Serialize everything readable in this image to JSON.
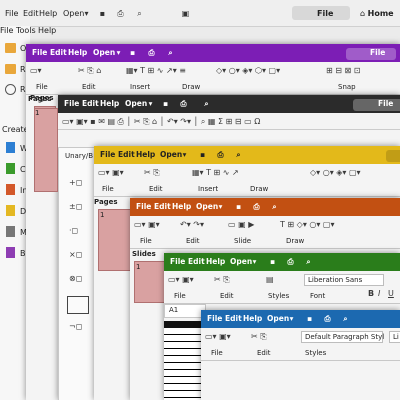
{
  "top_menu": {
    "file": "File",
    "edit": "Edit",
    "help": "Help",
    "open": "Open",
    "file_btn": "File",
    "home": "Home"
  },
  "start_center": {
    "menu": {
      "file": "File",
      "tools": "Tools",
      "help": "Help"
    },
    "create_label": "Create",
    "recent_letters": [
      "O",
      "R",
      "R"
    ],
    "create_letters": [
      "W",
      "C",
      "In",
      "D",
      "M",
      "B"
    ]
  },
  "purple": {
    "menu": {
      "file": "File",
      "edit": "Edit",
      "help": "Help",
      "open": "Open",
      "file_btn": "File"
    },
    "groups": {
      "file": "File",
      "edit": "Edit",
      "insert": "Insert",
      "draw": "Draw",
      "snap": "Snap"
    }
  },
  "black": {
    "menu": {
      "file": "File",
      "edit": "Edit",
      "help": "Help",
      "open": "Open",
      "file_btn": "File"
    },
    "pages_label": "Pages",
    "unary_label": "Unary/B",
    "page_num": "1"
  },
  "yellow": {
    "menu": {
      "file": "File",
      "edit": "Edit",
      "help": "Help",
      "open": "Open"
    },
    "groups": {
      "file": "File",
      "edit": "Edit",
      "insert": "Insert",
      "draw": "Draw"
    },
    "pages_label": "Pages",
    "page_num": "1"
  },
  "orange": {
    "menu": {
      "file": "File",
      "edit": "Edit",
      "help": "Help",
      "open": "Open"
    },
    "groups": {
      "file": "File",
      "edit": "Edit",
      "slide": "Slide",
      "draw": "Draw"
    },
    "slides_label": "Slides",
    "slide_num": "1"
  },
  "green": {
    "menu": {
      "file": "File",
      "edit": "Edit",
      "help": "Help",
      "open": "Open"
    },
    "groups": {
      "file": "File",
      "edit": "Edit",
      "styles": "Styles",
      "font": "Font"
    },
    "font_name": "Liberation Sans",
    "cell_ref": "A1"
  },
  "blue": {
    "menu": {
      "file": "File",
      "edit": "Edit",
      "help": "Help",
      "open": "Open"
    },
    "groups": {
      "file": "File",
      "edit": "Edit",
      "styles": "Styles"
    },
    "para_style": "Default Paragraph Styl",
    "font_partial": "Li"
  },
  "colors": {
    "purple": "#7c1eb5",
    "black": "#2b2b2b",
    "yellow": "#e3b91a",
    "orange": "#c25012",
    "green": "#2a7d1b",
    "blue": "#1c69b0"
  }
}
